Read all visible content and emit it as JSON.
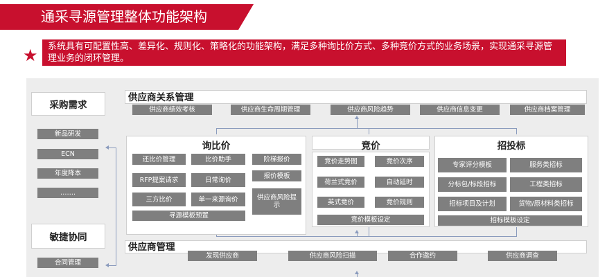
{
  "title": "通采寻源管理整体功能架构",
  "intro": "系统具有可配置性高、差异化、规则化、策略化的功能架构，满足多种询比价方式、多种竞价方式的业务场景，实现通采寻源管理业务的闭环管理。",
  "left": {
    "purchase_demand": "采购需求",
    "demand_items": [
      "新品研发",
      "ECN",
      "年度降本",
      "……."
    ],
    "agile": "敏捷协同",
    "agile_items": [
      "合同管理"
    ]
  },
  "srm": {
    "title": "供应商关系管理",
    "items": [
      "供应商绩效考核",
      "供应商生命周期管理",
      "供应商风险趋势",
      "供应商信息变更",
      "供应商档案管理"
    ]
  },
  "inquiry": {
    "title": "询比价",
    "items": [
      "还比价管理",
      "比价助手",
      "阶梯报价",
      "RFP提案请求",
      "日常询价",
      "报价模板",
      "三方比价",
      "单一来源询价",
      "供应商风险提示"
    ],
    "template": "寻源模板预置"
  },
  "bidding": {
    "title": "竞价",
    "items": [
      "竞价走势图",
      "竞价次序",
      "荷兰式竞价",
      "自动延时",
      "英式竞价",
      "竞价规则"
    ],
    "template": "竞价模板设定"
  },
  "tender": {
    "title": "招投标",
    "items": [
      "专家评分模板",
      "服务类招标",
      "分标包/标段招标",
      "工程类招标",
      "招标项目及计划",
      "货物/原材料类招标"
    ],
    "template": "招标模板设定"
  },
  "supplier_mgmt": {
    "title": "供应商管理",
    "items": [
      "发现供应商",
      "供应商风险扫描",
      "合作邀约",
      "供应商调查"
    ]
  },
  "colors": {
    "accent": "#c8102e",
    "box": "#7f7f7f",
    "panel": "#ededed",
    "connector": "#8a9bbd"
  }
}
